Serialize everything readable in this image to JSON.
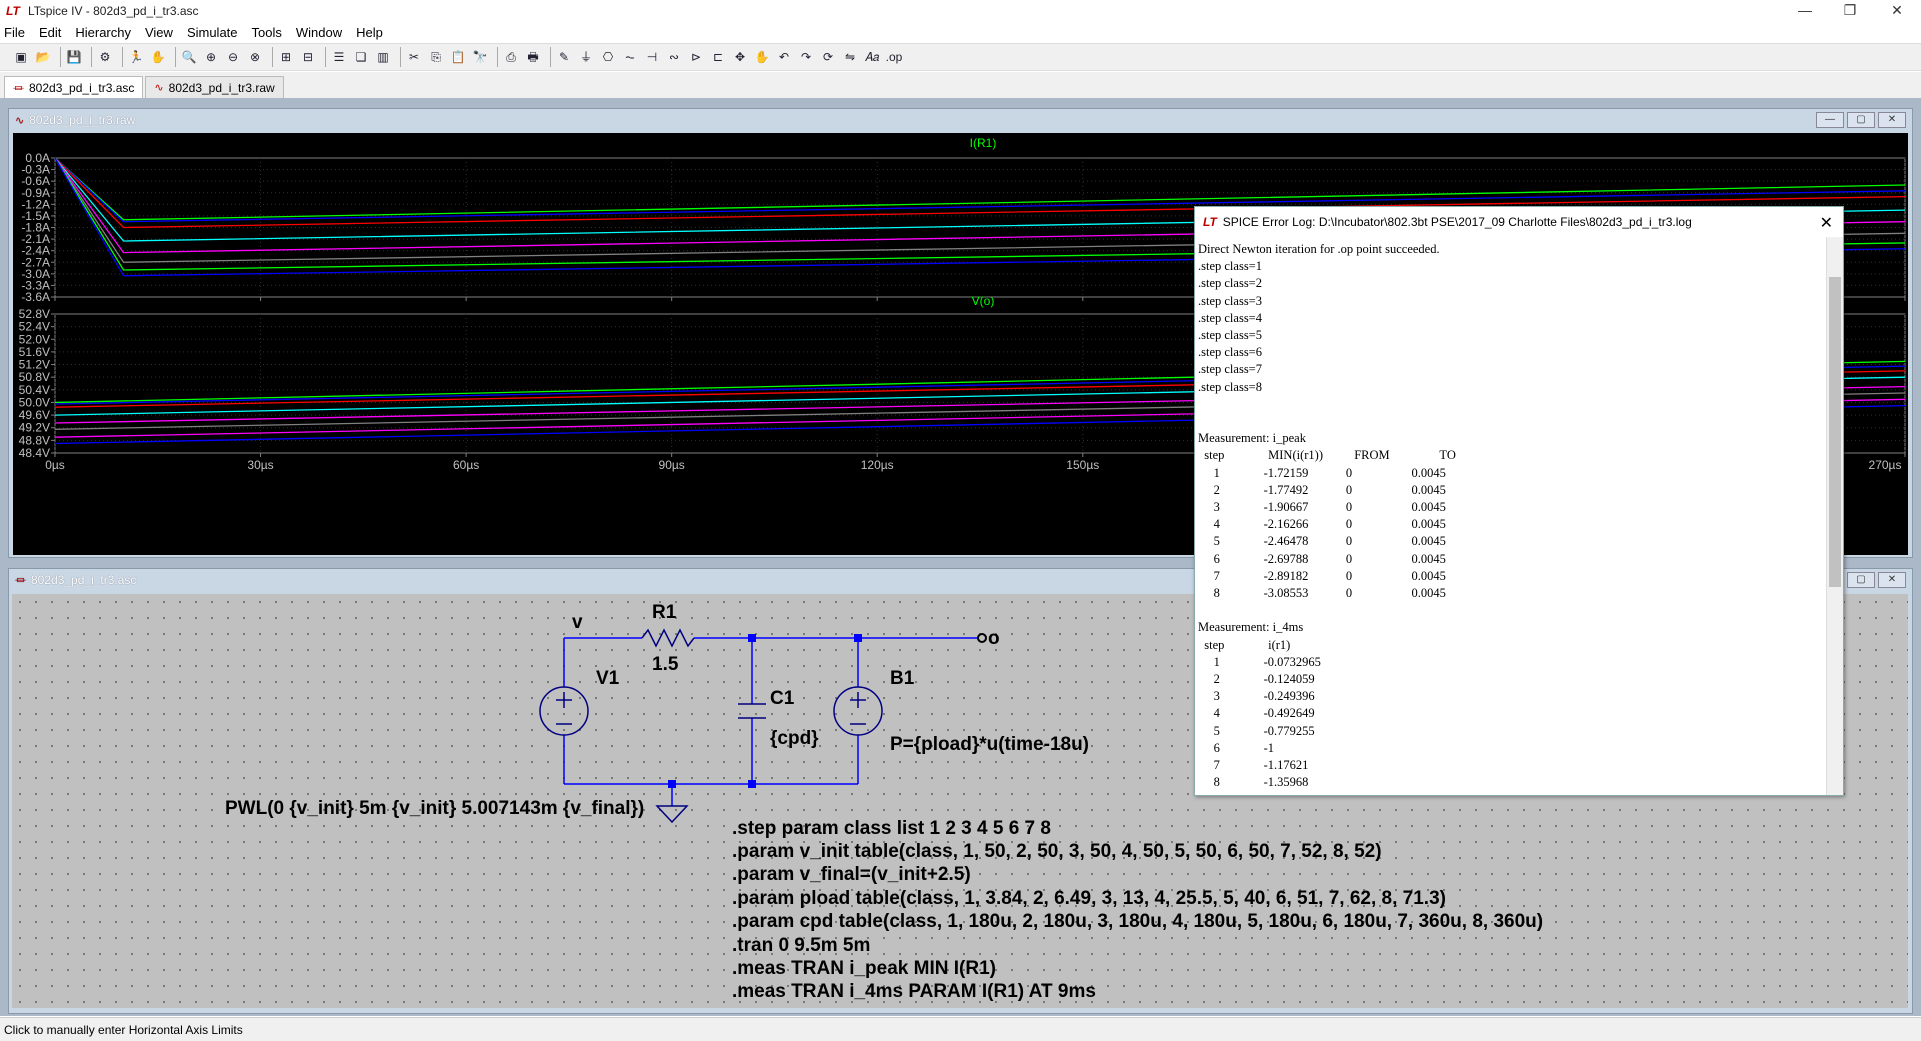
{
  "app": {
    "title": "LTspice IV - 802d3_pd_i_tr3.asc",
    "logo": "LT"
  },
  "menu": [
    "File",
    "Edit",
    "Hierarchy",
    "View",
    "Simulate",
    "Tools",
    "Window",
    "Help"
  ],
  "tabs": [
    {
      "label": "802d3_pd_i_tr3.asc",
      "icon": "schematic-icon",
      "active": true
    },
    {
      "label": "802d3_pd_i_tr3.raw",
      "icon": "waveform-icon",
      "active": false
    }
  ],
  "waveform_window": {
    "title": "802d3_pd_i_tr3.raw"
  },
  "schematic_window": {
    "title": "802d3_pd_i_tr3.asc"
  },
  "chart_data": [
    {
      "type": "line",
      "title": "I(R1)",
      "title_color": "#00ff00",
      "yticks": [
        "0.0A",
        "-0.3A",
        "-0.6A",
        "-0.9A",
        "-1.2A",
        "-1.5A",
        "-1.8A",
        "-2.1A",
        "-2.4A",
        "-2.7A",
        "-3.0A",
        "-3.3A",
        "-3.6A"
      ],
      "ylim": [
        -3.6,
        0.0
      ],
      "x_unit": "µs",
      "xlim": [
        0,
        270
      ],
      "series": [
        {
          "color": "#00ff00",
          "values": [
            [
              0,
              0
            ],
            [
              10,
              -1.6
            ],
            [
              270,
              -0.7
            ]
          ]
        },
        {
          "color": "#0000ff",
          "values": [
            [
              0,
              0
            ],
            [
              10,
              -1.65
            ],
            [
              270,
              -0.85
            ]
          ]
        },
        {
          "color": "#ff0000",
          "values": [
            [
              0,
              0
            ],
            [
              10,
              -1.8
            ],
            [
              270,
              -1.0
            ]
          ]
        },
        {
          "color": "#00ffff",
          "values": [
            [
              0,
              0
            ],
            [
              10,
              -2.15
            ],
            [
              270,
              -1.35
            ]
          ]
        },
        {
          "color": "#ff00ff",
          "values": [
            [
              0,
              0
            ],
            [
              10,
              -2.45
            ],
            [
              270,
              -1.65
            ]
          ]
        },
        {
          "color": "#808080",
          "values": [
            [
              0,
              0
            ],
            [
              10,
              -2.7
            ],
            [
              270,
              -1.95
            ]
          ]
        },
        {
          "color": "#00ff00",
          "values": [
            [
              0,
              0
            ],
            [
              10,
              -2.9
            ],
            [
              270,
              -2.2
            ]
          ]
        },
        {
          "color": "#0000ff",
          "values": [
            [
              0,
              0
            ],
            [
              10,
              -3.05
            ],
            [
              270,
              -2.35
            ]
          ]
        }
      ]
    },
    {
      "type": "line",
      "title": "V(o)",
      "title_color": "#00ff00",
      "yticks": [
        "52.8V",
        "52.4V",
        "52.0V",
        "51.6V",
        "51.2V",
        "50.8V",
        "50.4V",
        "50.0V",
        "49.6V",
        "49.2V",
        "48.8V",
        "48.4V"
      ],
      "ylim": [
        48.4,
        52.8
      ],
      "xticks": [
        "0µs",
        "30µs",
        "60µs",
        "90µs",
        "120µs",
        "150µs",
        "270µs"
      ],
      "xtick_values": [
        0,
        30,
        60,
        90,
        120,
        150,
        270
      ],
      "xlim": [
        0,
        270
      ],
      "series": [
        {
          "color": "#00ff00",
          "values": [
            [
              0,
              50.0
            ],
            [
              270,
              51.3
            ]
          ]
        },
        {
          "color": "#0000ff",
          "values": [
            [
              0,
              49.95
            ],
            [
              270,
              51.15
            ]
          ]
        },
        {
          "color": "#ff0000",
          "values": [
            [
              0,
              49.85
            ],
            [
              270,
              51.0
            ]
          ]
        },
        {
          "color": "#00ffff",
          "values": [
            [
              0,
              49.6
            ],
            [
              270,
              50.8
            ]
          ]
        },
        {
          "color": "#ff00ff",
          "values": [
            [
              0,
              49.35
            ],
            [
              270,
              50.5
            ]
          ]
        },
        {
          "color": "#808080",
          "values": [
            [
              0,
              49.15
            ],
            [
              270,
              50.3
            ]
          ]
        },
        {
          "color": "#ff00ff",
          "values": [
            [
              0,
              48.9
            ],
            [
              270,
              50.1
            ]
          ]
        },
        {
          "color": "#0000ff",
          "values": [
            [
              0,
              48.7
            ],
            [
              270,
              49.9
            ]
          ]
        }
      ]
    }
  ],
  "log": {
    "title": "SPICE Error Log: D:\\Incubator\\802.3bt PSE\\2017_09 Charlotte Files\\802d3_pd_i_tr3.log",
    "body": "Direct Newton iteration for .op point succeeded.\n.step class=1\n.step class=2\n.step class=3\n.step class=4\n.step class=5\n.step class=6\n.step class=7\n.step class=8\n\n\nMeasurement: i_peak\n  step              MIN(i(r1))          FROM                TO\n     1              -1.72159            0                   0.0045\n     2              -1.77492            0                   0.0045\n     3              -1.90667            0                   0.0045\n     4              -2.16266            0                   0.0045\n     5              -2.46478            0                   0.0045\n     6              -2.69788            0                   0.0045\n     7              -2.89182            0                   0.0045\n     8              -3.08553            0                   0.0045\n\nMeasurement: i_4ms\n  step              i(r1)\n     1              -0.0732965\n     2              -0.124059\n     3              -0.249396\n     4              -0.492649\n     5              -0.779255\n     6              -1\n     7              -1.17621\n     8              -1.35968"
  },
  "schematic": {
    "node_v": "v",
    "node_o": "o",
    "r1_name": "R1",
    "r1_value": "1.5",
    "v1_name": "V1",
    "c1_name": "C1",
    "c1_value": "{cpd}",
    "b1_name": "B1",
    "b1_value": "P={pload}*u(time-18u)",
    "v1_value": "PWL(0 {v_init} 5m {v_init} 5.007143m {v_final})",
    "directives": [
      ".step param class list 1 2 3 4 5 6 7 8",
      ".param v_init table(class, 1, 50, 2, 50, 3, 50, 4, 50, 5, 50, 6, 50, 7, 52, 8, 52)",
      ".param v_final=(v_init+2.5)",
      ".param pload table(class, 1, 3.84, 2, 6.49, 3, 13, 4, 25.5, 5, 40, 6, 51, 7, 62, 8, 71.3)",
      ".param cpd table(class, 1, 180u, 2, 180u, 3, 180u, 4, 180u, 5, 180u, 6, 180u, 7, 360u, 8, 360u)",
      ".tran 0 9.5m 5m",
      ".meas TRAN i_peak MIN I(R1)",
      ".meas TRAN i_4ms PARAM I(R1) AT 9ms"
    ]
  },
  "status": "Click to manually enter Horizontal Axis Limits",
  "colors": {
    "wire": "#0000ff",
    "component": "#000080",
    "plot_bg": "#000000",
    "grid": "#404040",
    "mdi_bg": "#abb8c8"
  }
}
